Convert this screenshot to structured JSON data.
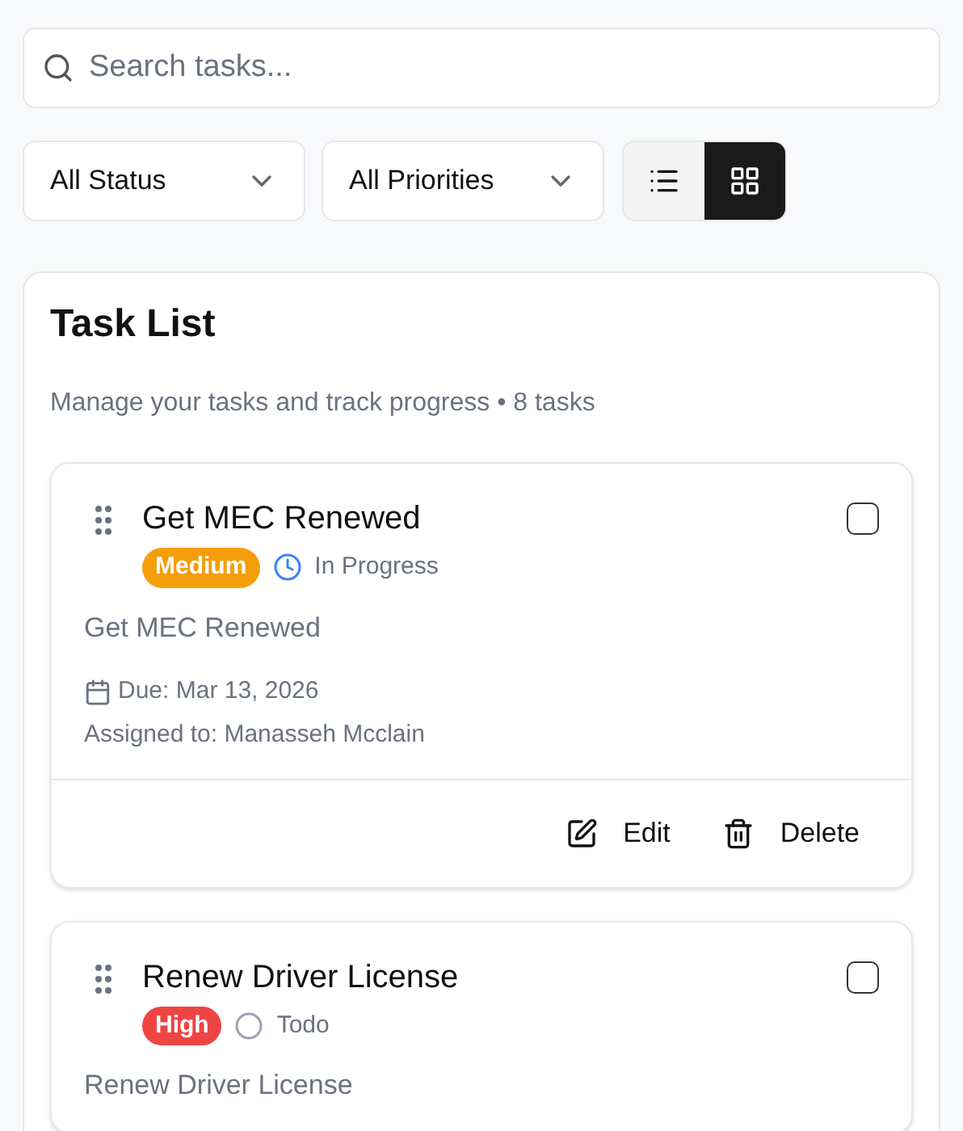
{
  "search": {
    "placeholder": "Search tasks..."
  },
  "filters": [
    {
      "value": "All Status"
    },
    {
      "value": "All Priorities"
    }
  ],
  "view_toggle": [
    {
      "kind": "list",
      "selected": false
    },
    {
      "kind": "grid",
      "selected": true
    }
  ],
  "task_list": {
    "title": "Task List",
    "subtitle": "Manage your tasks and track progress • 8 tasks",
    "tasks": [
      {
        "title": "Get MEC Renewed",
        "checked": false,
        "priority": {
          "label": "Medium",
          "color": "#f59e0b"
        },
        "status": {
          "kind": "in_progress",
          "label": "In Progress"
        },
        "description": "Get MEC Renewed",
        "due": "Due: Mar 13, 2026",
        "assigned": "Assigned to: Manasseh Mcclain",
        "actions": [
          {
            "kind": "edit",
            "label": "Edit"
          },
          {
            "kind": "delete",
            "label": "Delete"
          }
        ]
      },
      {
        "title": "Renew Driver License",
        "checked": false,
        "priority": {
          "label": "High",
          "color": "#ef4444"
        },
        "status": {
          "kind": "todo",
          "label": "Todo"
        },
        "description": "Renew Driver License"
      }
    ]
  }
}
